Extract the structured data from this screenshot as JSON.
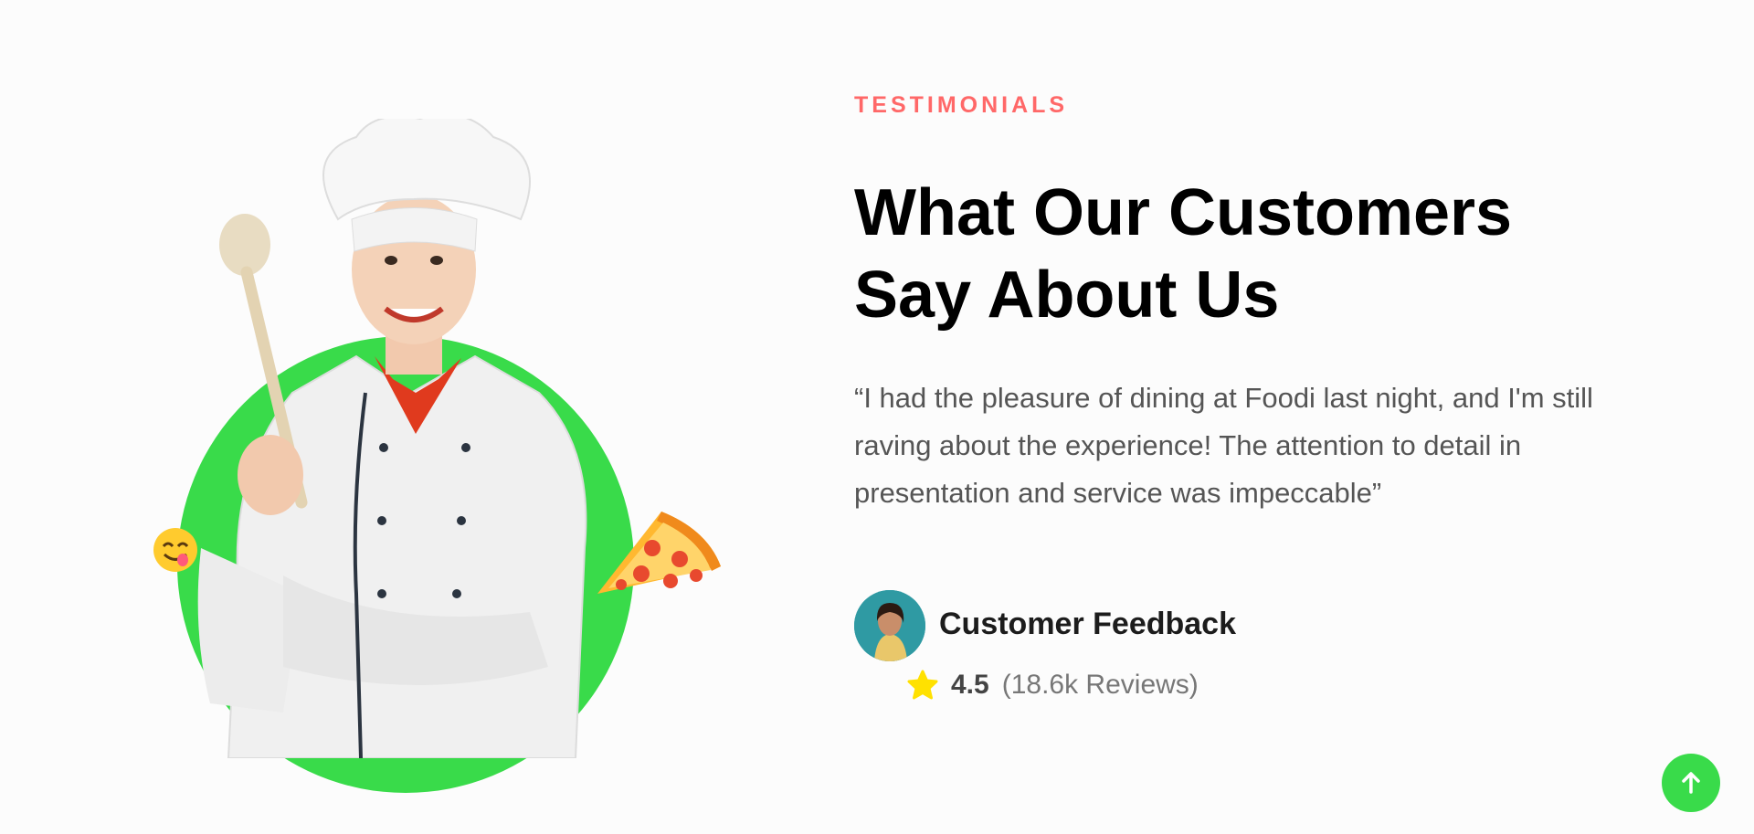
{
  "section": {
    "eyebrow": "TESTIMONIALS",
    "headline": "What Our Customers Say About Us",
    "quote": "“I had the pleasure of dining at Foodi last night, and I'm still raving about the experience! The attention to detail in presentation and service was impeccable”"
  },
  "feedback": {
    "title": "Customer Feedback",
    "rating": "4.5",
    "reviews": "(18.6k Reviews)"
  },
  "icons": {
    "star": "star-icon",
    "scroll_top": "arrow-up-icon",
    "emoji": "yum-face-icon",
    "pizza": "pizza-icon"
  },
  "colors": {
    "accent_red": "#ff6868",
    "brand_green": "#39db4a",
    "star_yellow": "#ffe100"
  }
}
